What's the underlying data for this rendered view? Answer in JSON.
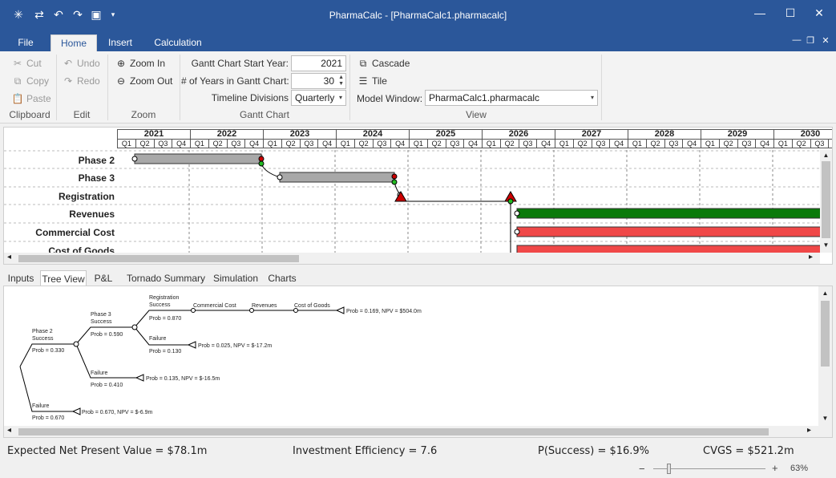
{
  "titlebar": {
    "title": "PharmaCalc - [PharmaCalc1.pharmacalc]",
    "quick_access": [
      "new-icon",
      "swap-icon",
      "undo-icon",
      "redo-icon",
      "save-icon",
      "customize-icon"
    ],
    "controls": [
      "—",
      "☐",
      "✕"
    ]
  },
  "menu": {
    "tabs": [
      "File",
      "Home",
      "Insert",
      "Calculation"
    ],
    "active": "Home",
    "mdi_controls": [
      "—",
      "❐",
      "✕"
    ]
  },
  "ribbon": {
    "clipboard": {
      "cut": "Cut",
      "copy": "Copy",
      "paste": "Paste",
      "label": "Clipboard"
    },
    "edit": {
      "undo": "Undo",
      "redo": "Redo",
      "label": "Edit"
    },
    "zoom": {
      "zoom_in": "Zoom In",
      "zoom_out": "Zoom Out",
      "label": "Zoom"
    },
    "gantt": {
      "start_year_label": "Gantt Chart Start Year:",
      "start_year": "2021",
      "years_label": "# of Years in Gantt Chart:",
      "years": "30",
      "divisions_label": "Timeline Divisions",
      "divisions": "Quarterly",
      "label": "Gantt Chart"
    },
    "view": {
      "cascade": "Cascade",
      "tile": "Tile",
      "model_window_label": "Model Window:",
      "model_window": "PharmaCalc1.pharmacalc",
      "label": "View"
    }
  },
  "gantt": {
    "years": [
      "2021",
      "2022",
      "2023",
      "2024",
      "2025",
      "2026",
      "2027",
      "2028",
      "2029",
      "2030"
    ],
    "quarters": [
      "Q1",
      "Q2",
      "Q3",
      "Q4"
    ],
    "rows": [
      "Phase 2",
      "Phase 3",
      "Registration",
      "Revenues",
      "Commercial Cost",
      "Cost of Goods"
    ],
    "colors": {
      "phase": "#a8a8a8",
      "revenues": "#0a7a0a",
      "cost": "#f04848",
      "milestone": "#cc0000",
      "ok": "#22bb22"
    }
  },
  "bottom_tabs": [
    "Inputs",
    "Tree View",
    "P&L",
    "Tornado Summary",
    "Simulation",
    "Charts"
  ],
  "active_bottom_tab": "Tree View",
  "tree": {
    "phase2_success": [
      "Phase 2",
      "Success"
    ],
    "phase2_prob": "Prob = 0.330",
    "phase3_success": [
      "Phase 3",
      "Success"
    ],
    "phase3_prob": "Prob = 0.590",
    "reg_success": [
      "Registration",
      "Success"
    ],
    "reg_prob": "Prob = 0.870",
    "commercial_cost": "Commercial Cost",
    "revenues": "Revenues",
    "cost_of_goods": "Cost of Goods",
    "end_success": "Prob = 0.169, NPV = $504.0m",
    "reg_failure": "Failure",
    "reg_failure_prob": "Prob = 0.130",
    "end_reg_failure": "Prob = 0.025, NPV = $-17.2m",
    "p3_failure": "Failure",
    "p3_failure_prob": "Prob = 0.410",
    "end_p3_failure": "Prob = 0.135, NPV = $-16.5m",
    "p2_failure": "Failure",
    "p2_failure_prob": "Prob = 0.670",
    "end_p2_failure": "Prob = 0.670, NPV = $-6.9m"
  },
  "status": {
    "enpv": "Expected Net Present Value = $78.1m",
    "efficiency": "Investment Efficiency = 7.6",
    "psuccess": "P(Success) = $16.9%",
    "cvgs": "CVGS = $521.2m"
  },
  "zoom": {
    "minus": "−",
    "plus": "+",
    "level": "63%"
  }
}
